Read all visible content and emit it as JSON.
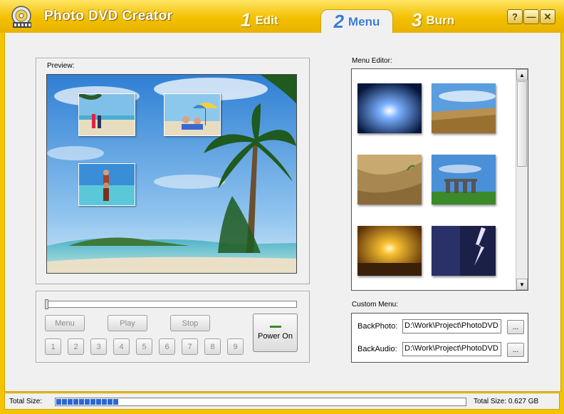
{
  "app": {
    "title": "Photo DVD Creator"
  },
  "tabs": [
    {
      "num": "1",
      "label": "Edit",
      "active": false
    },
    {
      "num": "2",
      "label": "Menu",
      "active": true
    },
    {
      "num": "3",
      "label": "Burn",
      "active": false
    }
  ],
  "window_buttons": {
    "help": "?",
    "minimize": "—",
    "close": "✕"
  },
  "preview": {
    "label": "Preview:",
    "thumbnails": [
      "beach-couple-walking",
      "couple-under-umbrella",
      "child-on-shoulders"
    ],
    "background": "tropical-beach-palms"
  },
  "player": {
    "slider_position": 0,
    "menu_label": "Menu",
    "play_label": "Play",
    "stop_label": "Stop",
    "power_label": "Power On",
    "numbers": [
      "1",
      "2",
      "3",
      "4",
      "5",
      "6",
      "7",
      "8",
      "9"
    ]
  },
  "menu_editor": {
    "label": "Menu Editor:",
    "backgrounds": [
      "blue-light-burst",
      "wheat-field",
      "desert-sand-plant",
      "stonehenge",
      "golden-sunset",
      "lightning-storm"
    ]
  },
  "custom_menu": {
    "label": "Custom Menu:",
    "back_photo_label": "BackPhoto:",
    "back_photo_value": "D:\\Work\\Project\\PhotoDVD",
    "back_audio_label": "BackAudio:",
    "back_audio_value": "D:\\Work\\Project\\PhotoDVD",
    "browse_label": "..."
  },
  "status": {
    "total_size_label": "Total Size:",
    "progress_segments": 11,
    "total_size_text": "Total Size: 0.627 GB"
  },
  "colors": {
    "accent": "#f4c400",
    "tab_active": "#3a7ad8",
    "progress": "#2a66d8"
  }
}
